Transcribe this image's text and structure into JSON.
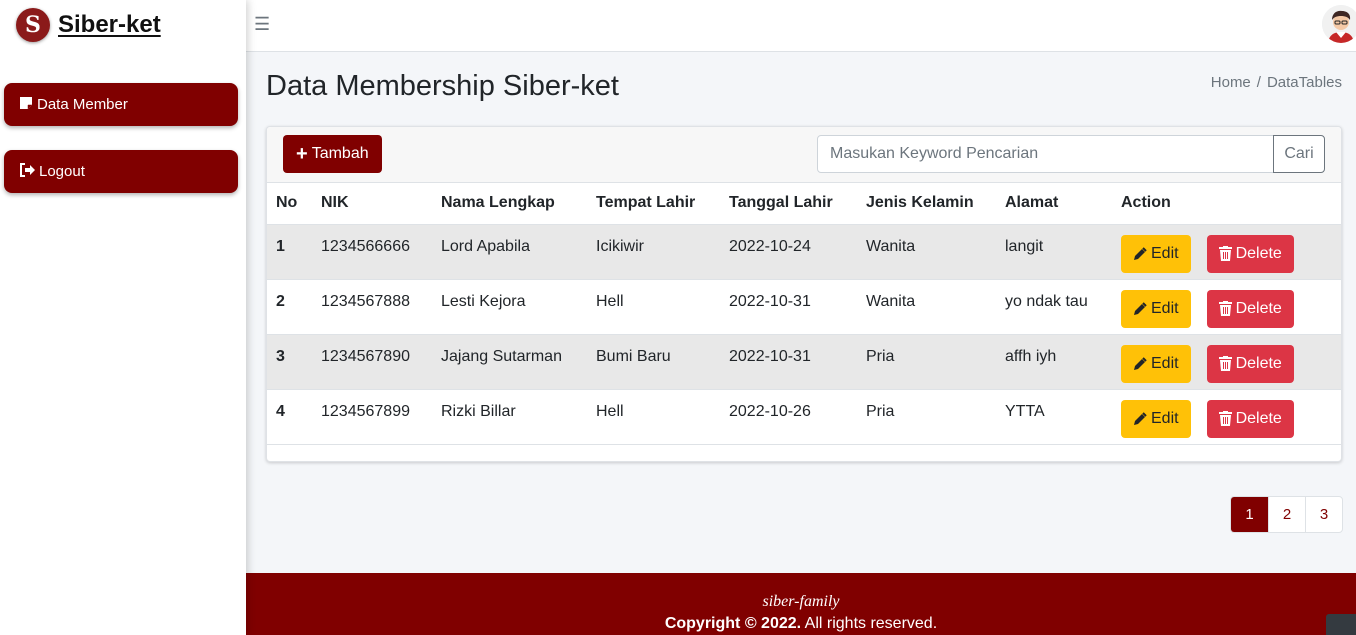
{
  "brand": {
    "name": "Siber-ket",
    "logo_letter": "S"
  },
  "sidebar": {
    "items": [
      {
        "label": "Data Member",
        "icon": "note-icon"
      },
      {
        "label": "Logout",
        "icon": "logout-icon"
      }
    ]
  },
  "header": {
    "title": "Data Membership Siber-ket",
    "breadcrumb": [
      "Home",
      "DataTables"
    ]
  },
  "toolbar": {
    "add_label": "Tambah",
    "search_placeholder": "Masukan Keyword Pencarian",
    "search_button": "Cari"
  },
  "table": {
    "columns": [
      "No",
      "NIK",
      "Nama Lengkap",
      "Tempat Lahir",
      "Tanggal Lahir",
      "Jenis Kelamin",
      "Alamat",
      "Action"
    ],
    "rows": [
      {
        "no": "1",
        "nik": "1234566666",
        "nama": "Lord Apabila",
        "tempat": "Icikiwir",
        "tanggal": "2022-10-24",
        "jk": "Wanita",
        "alamat": "langit"
      },
      {
        "no": "2",
        "nik": "1234567888",
        "nama": "Lesti Kejora",
        "tempat": "Hell",
        "tanggal": "2022-10-31",
        "jk": "Wanita",
        "alamat": "yo ndak tau"
      },
      {
        "no": "3",
        "nik": "1234567890",
        "nama": "Jajang Sutarman",
        "tempat": "Bumi Baru",
        "tanggal": "2022-10-31",
        "jk": "Pria",
        "alamat": "affh iyh"
      },
      {
        "no": "4",
        "nik": "1234567899",
        "nama": "Rizki Billar",
        "tempat": "Hell",
        "tanggal": "2022-10-26",
        "jk": "Pria",
        "alamat": "YTTA"
      }
    ],
    "edit_label": "Edit",
    "delete_label": "Delete"
  },
  "pagination": {
    "pages": [
      "1",
      "2",
      "3"
    ],
    "active": "1"
  },
  "footer": {
    "brand": "siber-family",
    "copyright_bold": "Copyright © 2022.",
    "copyright_rest": " All rights reserved."
  },
  "colors": {
    "primary": "#800000",
    "warning": "#ffc107",
    "danger": "#dc3545"
  }
}
